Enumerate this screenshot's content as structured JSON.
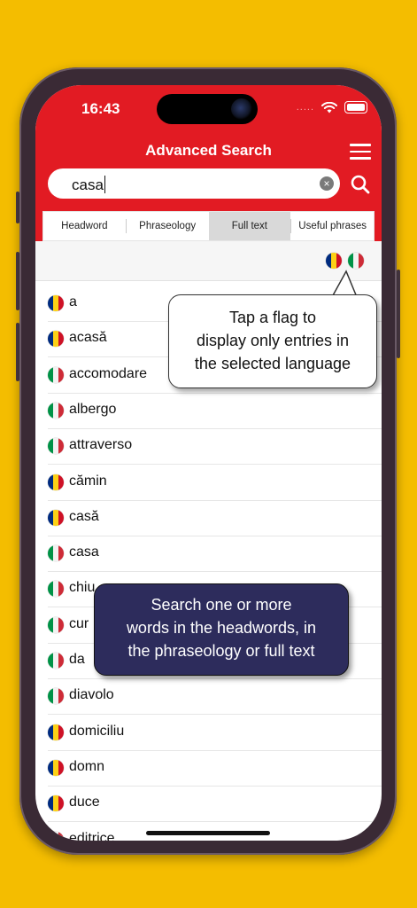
{
  "status": {
    "time": "16:43",
    "dots": "....."
  },
  "header": {
    "title": "Advanced Search"
  },
  "search": {
    "value": "casa",
    "clear": "×"
  },
  "tabs": [
    {
      "label": "Headword"
    },
    {
      "label": "Phraseology"
    },
    {
      "label": "Full text",
      "active": true
    },
    {
      "label": "Useful phrases"
    }
  ],
  "filters": [
    {
      "lang": "ro"
    },
    {
      "lang": "it"
    }
  ],
  "results": [
    {
      "word": "a",
      "lang": "ro"
    },
    {
      "word": "acasă",
      "lang": "ro"
    },
    {
      "word": "accomodare",
      "lang": "it"
    },
    {
      "word": "albergo",
      "lang": "it"
    },
    {
      "word": "attraverso",
      "lang": "it"
    },
    {
      "word": "cămin",
      "lang": "ro"
    },
    {
      "word": "casă",
      "lang": "ro"
    },
    {
      "word": "casa",
      "lang": "it"
    },
    {
      "word": "chiu",
      "lang": "it"
    },
    {
      "word": "cur",
      "lang": "it"
    },
    {
      "word": "da",
      "lang": "it"
    },
    {
      "word": "diavolo",
      "lang": "it"
    },
    {
      "word": "domiciliu",
      "lang": "ro"
    },
    {
      "word": "domn",
      "lang": "ro"
    },
    {
      "word": "duce",
      "lang": "ro"
    },
    {
      "word": "editrice",
      "lang": "it"
    }
  ],
  "tooltips": {
    "flag_tip": [
      "Tap a flag to",
      "display only entries in",
      "the selected language"
    ],
    "search_tip": [
      "Search one or more",
      "words in the headwords, in",
      "the phraseology or full text"
    ]
  },
  "colors": {
    "accent": "#e21b23",
    "background": "#f4bd00",
    "tip_dark": "#2d2c5c"
  }
}
